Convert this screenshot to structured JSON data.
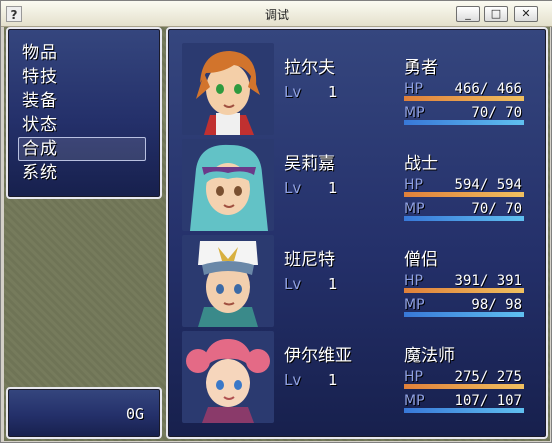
{
  "window": {
    "title": "调试",
    "help_icon": "?",
    "min_label": "_",
    "max_label": "□",
    "close_label": "✕"
  },
  "menu": {
    "items": [
      {
        "label": "物品"
      },
      {
        "label": "特技"
      },
      {
        "label": "装备"
      },
      {
        "label": "状态"
      },
      {
        "label": "合成"
      },
      {
        "label": "系统"
      }
    ],
    "selected_index": 4
  },
  "gold": {
    "value": "0",
    "unit": "G"
  },
  "actors": [
    {
      "name": "拉尔夫",
      "class": "勇者",
      "level_label": "Lv",
      "level": "1",
      "hp_label": "HP",
      "hp": "466",
      "hp_max": "466",
      "hp_fraction": 1.0,
      "mp_label": "MP",
      "mp": "70",
      "mp_max": "70",
      "mp_fraction": 1.0,
      "hair_color": "#d2742c",
      "eye_color": "#2e9a3e"
    },
    {
      "name": "吴莉嘉",
      "class": "战士",
      "level_label": "Lv",
      "level": "1",
      "hp_label": "HP",
      "hp": "594",
      "hp_max": "594",
      "hp_fraction": 1.0,
      "mp_label": "MP",
      "mp": "70",
      "mp_max": "70",
      "mp_fraction": 1.0,
      "hair_color": "#62c2c6",
      "eye_color": "#7a5030"
    },
    {
      "name": "班尼特",
      "class": "僧侣",
      "level_label": "Lv",
      "level": "1",
      "hp_label": "HP",
      "hp": "391",
      "hp_max": "391",
      "hp_fraction": 1.0,
      "mp_label": "MP",
      "mp": "98",
      "mp_max": "98",
      "mp_fraction": 1.0,
      "hair_color": "#6a88a8",
      "eye_color": "#3c6aa6"
    },
    {
      "name": "伊尔维亚",
      "class": "魔法师",
      "level_label": "Lv",
      "level": "1",
      "hp_label": "HP",
      "hp": "275",
      "hp_max": "275",
      "hp_fraction": 1.0,
      "mp_label": "MP",
      "mp": "107",
      "mp_max": "107",
      "mp_fraction": 1.0,
      "hair_color": "#e46a86",
      "eye_color": "#3a78c8"
    }
  ],
  "colors": {
    "hp_gauge": [
      "#e0803a",
      "#f0c060"
    ],
    "mp_gauge": [
      "#3878d8",
      "#60c0f0"
    ],
    "system_label": "#8fa0e0"
  }
}
